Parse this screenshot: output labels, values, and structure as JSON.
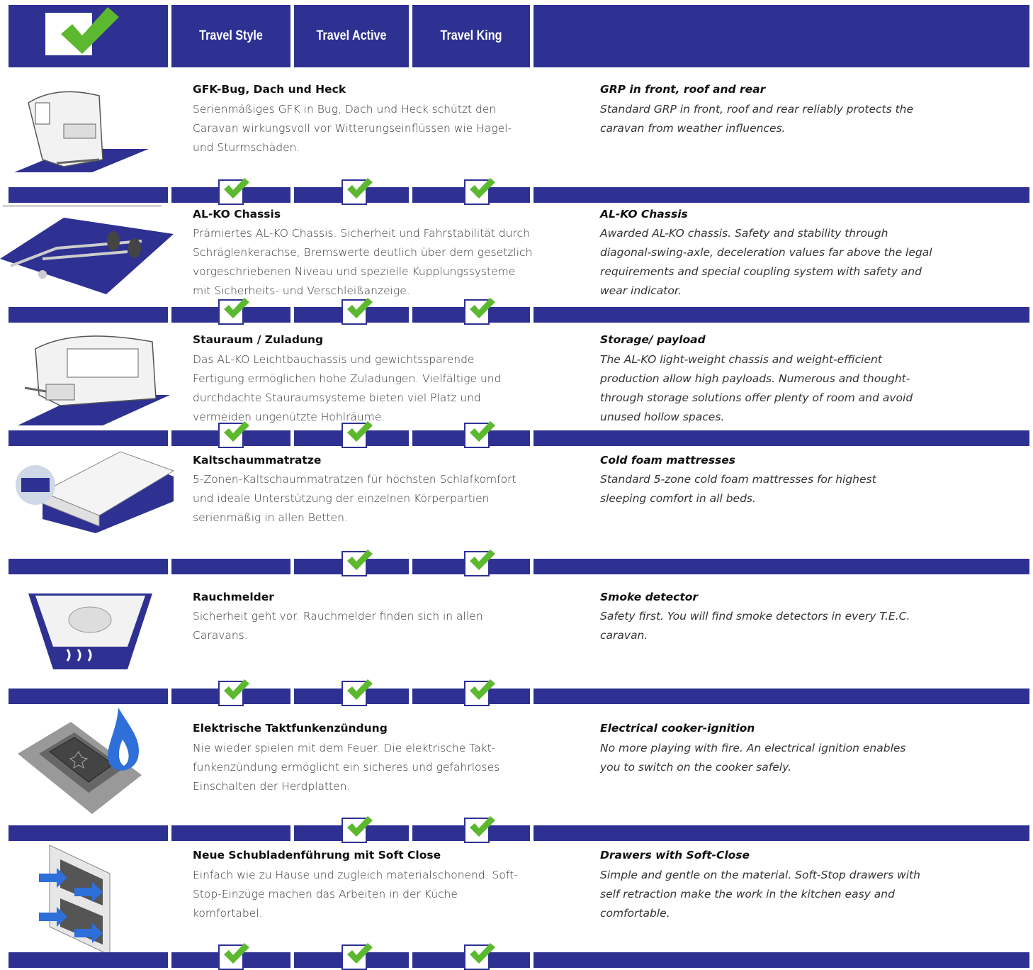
{
  "header": {
    "columns": [
      "Travel Style",
      "Travel Active",
      "Travel King"
    ]
  },
  "features": [
    {
      "icon": "caravan-grp-icon",
      "de_title": "GFK-Bug, Dach und Heck",
      "de_text": "Serienmäßiges GFK in Bug, Dach und Heck schützt den Caravan wirkungsvoll vor Witterungseinflüssen wie Hagel- und Sturmschäden.",
      "en_title": "GRP in front, roof and rear",
      "en_text": "Standard GRP in front, roof and rear reliably protects the caravan from weather influences.",
      "availability": [
        true,
        true,
        true
      ]
    },
    {
      "icon": "chassis-icon",
      "de_title": "AL-KO Chassis",
      "de_text": "Prämiertes AL-KO Chassis. Sicherheit und Fahrstabilität durch Schräglenkerachse, Bremswerte deutlich über dem gesetzlich vorgeschriebenen Niveau und spezielle Kupplungssysteme mit Sicherheits- und Verschleißanzeige.",
      "en_title": "AL-KO Chassis",
      "en_text": "Awarded AL-KO chassis. Safety and stability through diagonal-swing-axle, deceleration values far above the legal requirements and special coupling system with safety and wear indicator.",
      "availability": [
        true,
        true,
        true
      ]
    },
    {
      "icon": "storage-caravan-icon",
      "de_title": "Stauraum / Zuladung",
      "de_text": "Das AL-KO Leichtbauchassis und gewichtssparende Fertigung ermöglichen hohe Zuladungen. Vielfältige und durchdachte Stauraumsysteme bieten viel Platz und vermeiden ungenützte Hohlräume.",
      "en_title": "Storage/ payload",
      "en_text": "The AL-KO light-weight chassis and weight-efficient production allow high payloads. Numerous and thought-through storage solutions offer plenty of room and avoid unused hollow spaces.",
      "availability": [
        true,
        true,
        true
      ]
    },
    {
      "icon": "mattress-icon",
      "de_title": "Kaltschaummatratze",
      "de_text": "5-Zonen-Kaltschaummatratzen für höchsten Schlafkomfort und ideale Unterstützung der einzelnen Körperpartien serienmäßig in allen Betten.",
      "en_title": "Cold foam mattresses",
      "en_text": "Standard 5-zone cold foam mattresses for highest sleeping comfort in all beds.",
      "availability": [
        false,
        true,
        true
      ]
    },
    {
      "icon": "smoke-detector-icon",
      "de_title": "Rauchmelder",
      "de_text": "Sicherheit geht vor. Rauchmelder finden sich in allen Caravans.",
      "en_title": "Smoke detector",
      "en_text": "Safety first. You will find smoke detectors in every T.E.C. caravan.",
      "availability": [
        true,
        true,
        true
      ]
    },
    {
      "icon": "ignition-flame-icon",
      "de_title": "Elektrische Taktfunkenzündung",
      "de_text": "Nie wieder spielen mit dem Feuer. Die elektrische Takt-funkenzündung ermöglicht ein sicheres und gefahrloses Einschalten der Herdplatten.",
      "en_title": "Electrical cooker-ignition",
      "en_text": "No more playing with fire. An electrical ignition enables you to switch on the cooker safely.",
      "availability": [
        false,
        true,
        true
      ]
    },
    {
      "icon": "drawer-soft-close-icon",
      "de_title": "Neue Schubladenführung mit Soft Close",
      "de_text": "Einfach wie zu Hause und zugleich materialschonend. Soft-Stop-Einzüge machen das Arbeiten in der Küche komfortabel.",
      "en_title": "Drawers with Soft-Close",
      "en_text": "Simple and gentle on the material. Soft-Stop drawers with self retraction make the work in the kitchen easy and comfortable.",
      "availability": [
        true,
        true,
        true
      ]
    }
  ],
  "colors": {
    "navy": "#2e3192",
    "check_green": "#5cb82e"
  }
}
